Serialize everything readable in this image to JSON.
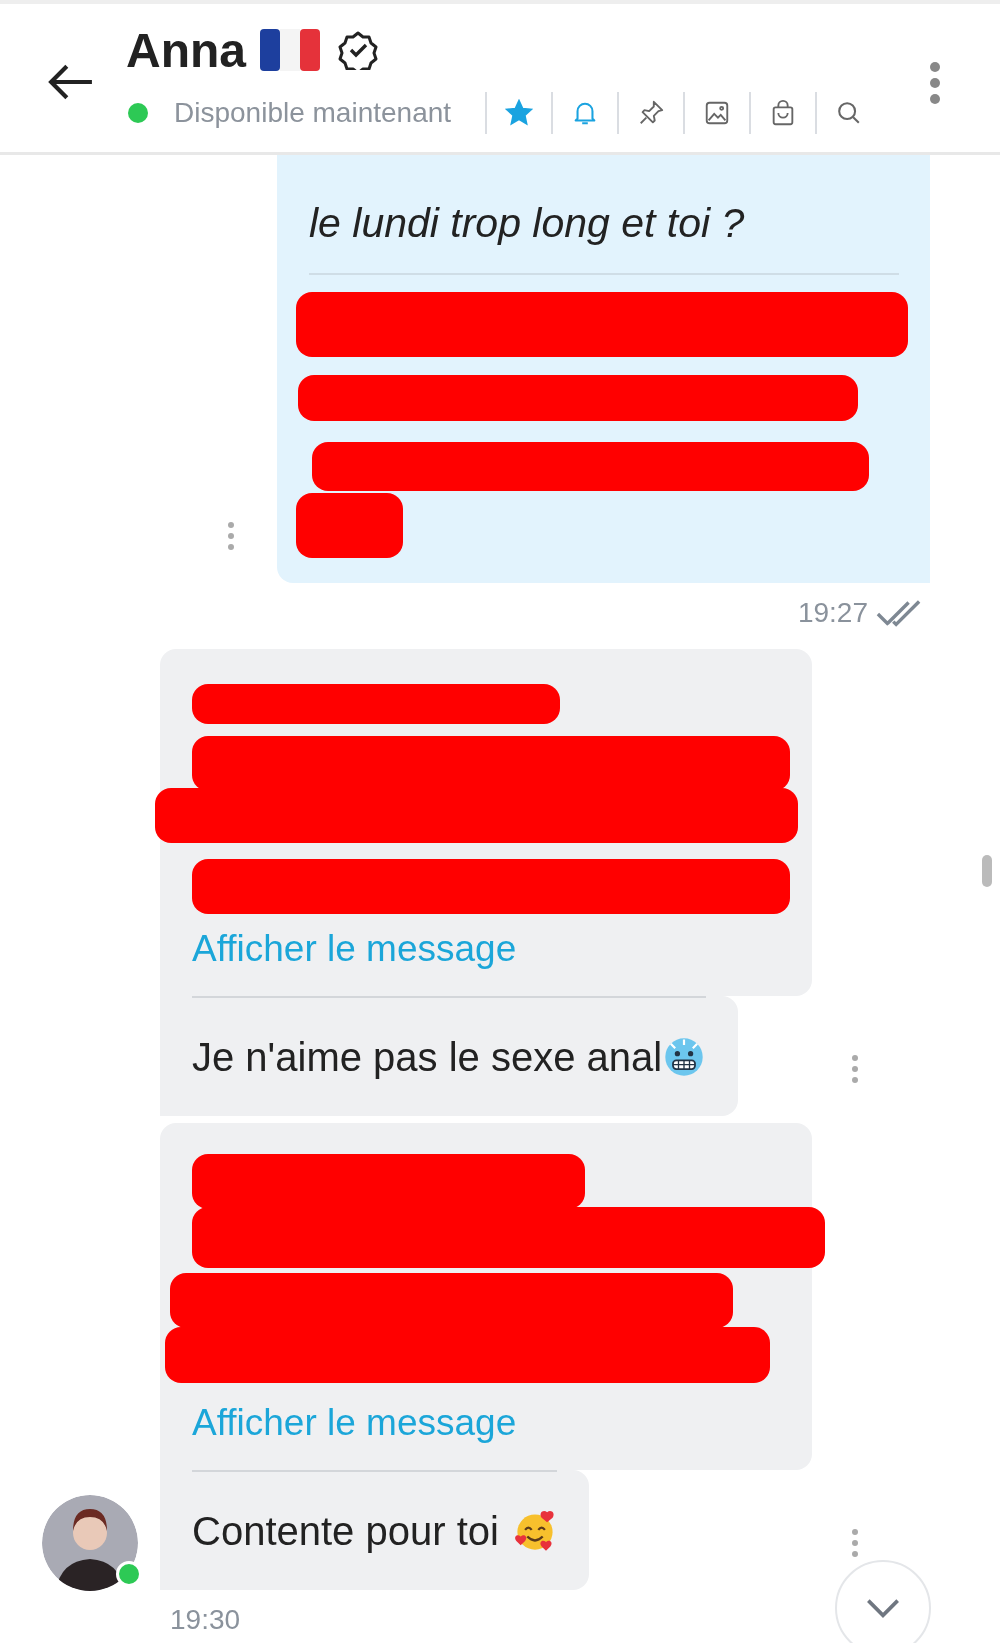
{
  "header": {
    "contact": {
      "name": "Anna",
      "status": "Disponible maintenant",
      "online": true,
      "verified": true
    },
    "toolbar": [
      {
        "kind": "star",
        "on": true
      },
      {
        "kind": "bell",
        "on": true
      },
      {
        "kind": "pin",
        "on": false
      },
      {
        "kind": "image",
        "on": false
      },
      {
        "kind": "bag",
        "on": false
      },
      {
        "kind": "search",
        "on": false
      }
    ]
  },
  "messages": [
    {
      "kind": "sent",
      "text": "le lundi trop long et toi ?",
      "time": "19:27",
      "read": true
    },
    {
      "kind": "received",
      "link": "Afficher le message",
      "text": "Je n'aime pas le sexe anal",
      "emoji": {
        "kind": "freezing"
      }
    },
    {
      "kind": "received",
      "link": "Afficher le message",
      "text": "Contente pour toi",
      "emoji": {
        "kind": "hearts"
      },
      "avatar": true,
      "online": true,
      "time": "19:30"
    }
  ]
}
